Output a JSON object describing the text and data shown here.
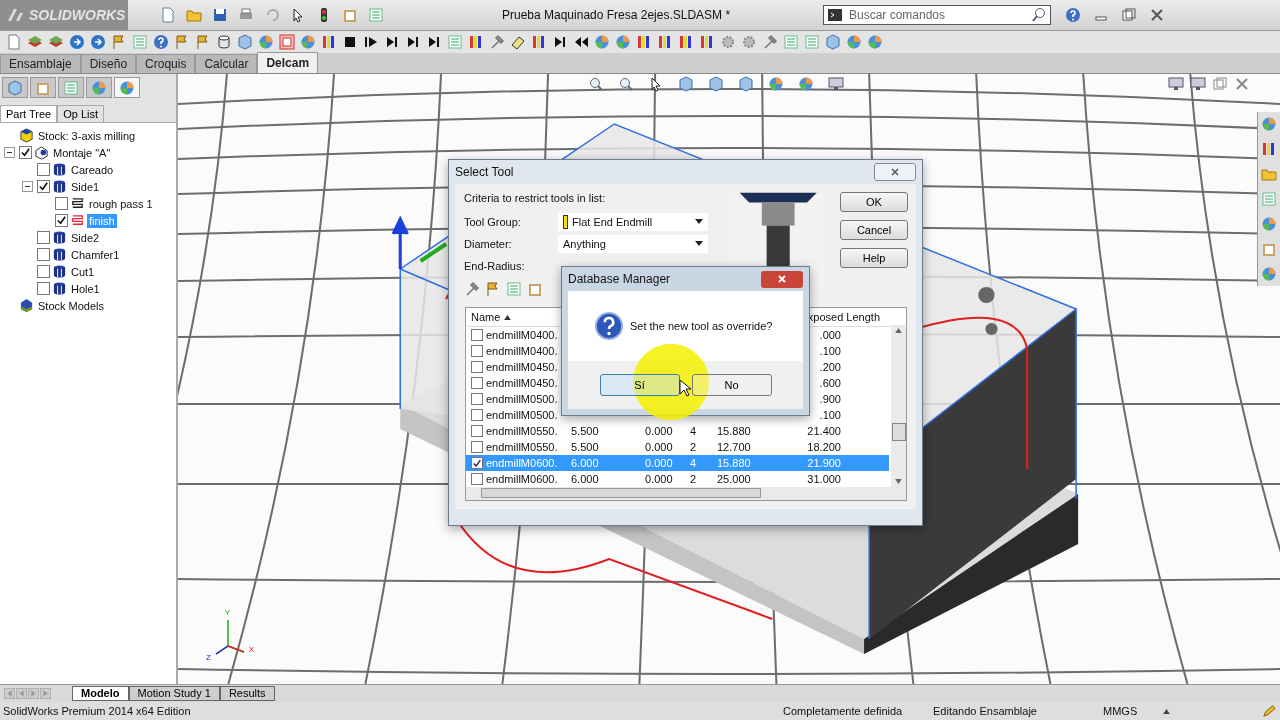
{
  "app": {
    "logo": "SOLIDWORKS",
    "title": "Prueba Maquinado Fresa 2ejes.SLDASM *",
    "search": {
      "placeholder": "Buscar comandos"
    }
  },
  "command_tabs": [
    {
      "label": "Ensamblaje",
      "selected": false
    },
    {
      "label": "Diseño",
      "selected": false
    },
    {
      "label": "Croquis",
      "selected": false
    },
    {
      "label": "Calcular",
      "selected": false
    },
    {
      "label": "Delcam",
      "selected": true
    }
  ],
  "panel_icon_tabs": [
    {
      "selected": false
    },
    {
      "selected": false
    },
    {
      "selected": false
    },
    {
      "selected": false
    },
    {
      "selected": true
    }
  ],
  "panel_tabs": [
    {
      "label": "Part Tree",
      "selected": true
    },
    {
      "label": "Op List",
      "selected": false
    }
  ],
  "tree": [
    {
      "label": "Stock: 3-axis milling",
      "kind": "stock",
      "selected": false
    },
    {
      "label": "Montaje \"A\"",
      "kind": "setup",
      "checked": true,
      "expanded": true,
      "selected": false,
      "children": [
        {
          "label": "Careado",
          "kind": "feature",
          "checked": false,
          "selected": false
        },
        {
          "label": "Side1",
          "kind": "feature",
          "checked": true,
          "expanded": true,
          "selected": false,
          "children": [
            {
              "label": "rough pass 1",
              "kind": "toolpath",
              "checked": false,
              "selected": false
            },
            {
              "label": "finish",
              "kind": "finish",
              "checked": true,
              "selected": true
            }
          ]
        },
        {
          "label": "Side2",
          "kind": "feature",
          "checked": false,
          "selected": false
        },
        {
          "label": "Chamfer1",
          "kind": "feature",
          "checked": false,
          "selected": false
        },
        {
          "label": "Cut1",
          "kind": "feature",
          "checked": false,
          "selected": false
        },
        {
          "label": "Hole1",
          "kind": "feature",
          "checked": false,
          "selected": false
        }
      ]
    },
    {
      "label": "Stock Models",
      "kind": "models",
      "selected": false
    }
  ],
  "triad": {
    "y": "Y",
    "x": "X",
    "z": "Z"
  },
  "select_tool": {
    "title": "Select Tool",
    "criteria": "Criteria to restrict tools in list:",
    "fields": [
      {
        "label": "Tool Group:",
        "value": "Flat End Endmill",
        "kind": "group"
      },
      {
        "label": "Diameter:",
        "value": "Anything",
        "kind": "plain"
      },
      {
        "label": "End-Radius:",
        "kind": "hidden"
      }
    ],
    "buttons": [
      "OK",
      "Cancel",
      "Help"
    ],
    "table": {
      "columns": [
        {
          "label": "Name",
          "sorted": true
        },
        {
          "label": "xposed Length",
          "sorted": false
        }
      ],
      "rows": [
        {
          "name": "endmillM0400.",
          "column_6": ".000",
          "checked": false,
          "selected": false
        },
        {
          "name": "endmillM0400.",
          "column_6": ".100",
          "checked": false,
          "selected": false
        },
        {
          "name": "endmillM0450.",
          "column_6": ".200",
          "checked": false,
          "selected": false
        },
        {
          "name": "endmillM0450.",
          "column_6": ".600",
          "checked": false,
          "selected": false
        },
        {
          "name": "endmillM0500.",
          "column_6": ".900",
          "checked": false,
          "selected": false
        },
        {
          "name": "endmillM0500.",
          "column_6": ".100",
          "checked": false,
          "selected": false
        },
        {
          "name": "endmillM0550.",
          "column_2": "5.500",
          "column_3": "0.000",
          "column_4": "4",
          "column_5": "15.880",
          "column_6": "21.400",
          "checked": false,
          "selected": false
        },
        {
          "name": "endmillM0550.",
          "column_2": "5.500",
          "column_3": "0.000",
          "column_4": "2",
          "column_5": "12.700",
          "column_6": "18.200",
          "checked": false,
          "selected": false
        },
        {
          "name": "endmillM0600.",
          "column_2": "6.000",
          "column_3": "0.000",
          "column_4": "4",
          "column_5": "15.880",
          "column_6": "21.900",
          "checked": true,
          "selected": true
        },
        {
          "name": "endmillM0600.",
          "column_2": "6.000",
          "column_3": "0.000",
          "column_4": "2",
          "column_5": "25.000",
          "column_6": "31.000",
          "checked": false,
          "selected": false
        }
      ]
    }
  },
  "confirm": {
    "title": "Database Manager",
    "message": "Set the new tool as override?",
    "buttons": [
      {
        "label": "Sí",
        "selected": true
      },
      {
        "label": "No",
        "selected": false
      }
    ]
  },
  "bottom_tabs": [
    {
      "label": "Modelo",
      "selected": true
    },
    {
      "label": "Motion Study 1",
      "selected": false
    },
    {
      "label": "Results",
      "selected": false
    }
  ],
  "status_bar": {
    "edition": "SolidWorks Premium 2014 x64 Edition",
    "state": "Completamente definida",
    "mode": "Editando Ensamblaje",
    "units": "MMGS"
  }
}
